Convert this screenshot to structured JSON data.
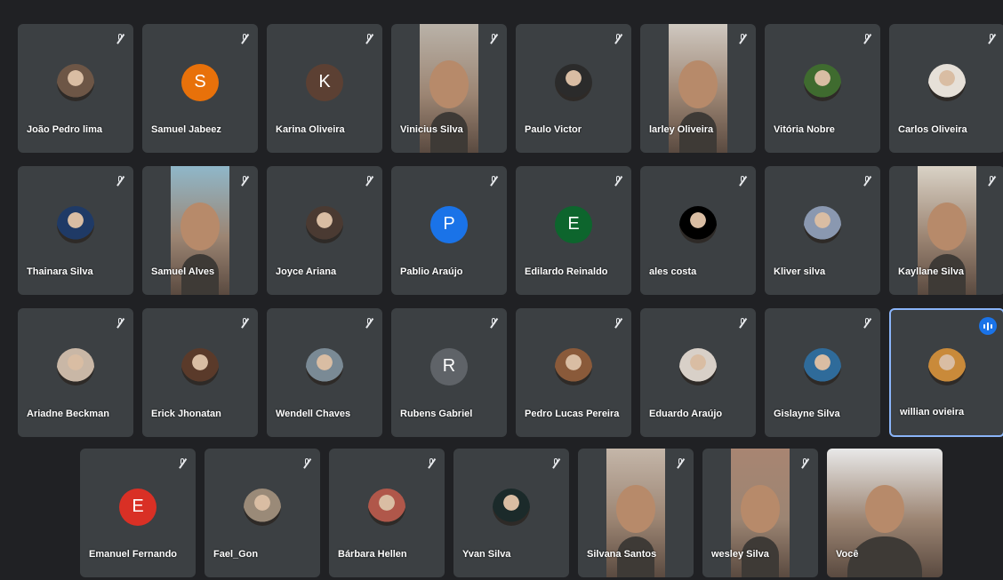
{
  "meeting": {
    "tiles": [
      {
        "name": "João Pedro lima",
        "type": "photo",
        "color": "#6d5646"
      },
      {
        "name": "Samuel Jabeez",
        "type": "initial",
        "initial": "S",
        "color": "#e8710a"
      },
      {
        "name": "Karina Oliveira",
        "type": "initial",
        "initial": "K",
        "color": "#5c4033"
      },
      {
        "name": "Vinicius Silva",
        "type": "video",
        "color": "#b9b2a8"
      },
      {
        "name": "Paulo Victor",
        "type": "photo",
        "color": "#2b2b2b"
      },
      {
        "name": "larley Oliveira",
        "type": "video",
        "color": "#cfc8c0"
      },
      {
        "name": "Vitória Nobre",
        "type": "photo",
        "color": "#3f6b2f"
      },
      {
        "name": "Carlos Oliveira",
        "type": "photo",
        "color": "#e6e0d8"
      },
      {
        "name": "Thainara Silva",
        "type": "photo",
        "color": "#1f3a66"
      },
      {
        "name": "Samuel Alves",
        "type": "video",
        "color": "#8fb7c9"
      },
      {
        "name": "Joyce Ariana",
        "type": "photo",
        "color": "#4a3a32"
      },
      {
        "name": "Pablio Araújo",
        "type": "initial",
        "initial": "P",
        "color": "#1a73e8"
      },
      {
        "name": "Edilardo Reinaldo",
        "type": "initial",
        "initial": "E",
        "color": "#0d652d"
      },
      {
        "name": "ales costa",
        "type": "photo",
        "color": "#000000"
      },
      {
        "name": "Kliver silva",
        "type": "photo",
        "color": "#8a98b0"
      },
      {
        "name": "Kayllane Silva",
        "type": "video",
        "color": "#d9d2c6"
      },
      {
        "name": "Ariadne Beckman",
        "type": "photo",
        "color": "#c9b7a6"
      },
      {
        "name": "Erick Jhonatan",
        "type": "photo",
        "color": "#5a3a2a"
      },
      {
        "name": "Wendell Chaves",
        "type": "photo",
        "color": "#7a8a95"
      },
      {
        "name": "Rubens Gabriel",
        "type": "initial",
        "initial": "R",
        "color": "#5f6368"
      },
      {
        "name": "Pedro Lucas Pereira",
        "type": "photo",
        "color": "#8a5a3a"
      },
      {
        "name": "Eduardo Araújo",
        "type": "photo",
        "color": "#d8d0c8"
      },
      {
        "name": "Gislayne Silva",
        "type": "photo",
        "color": "#2f6b9a"
      },
      {
        "name": "willian ovieira",
        "type": "photo",
        "color": "#c98a3a",
        "active": true
      },
      {
        "name": "Emanuel Fernando",
        "type": "initial",
        "initial": "E",
        "color": "#d93025"
      },
      {
        "name": "Fael_Gon",
        "type": "photo",
        "color": "#9a8a78"
      },
      {
        "name": "Bárbara Hellen",
        "type": "photo",
        "color": "#b0574a"
      },
      {
        "name": "Yvan Silva",
        "type": "photo",
        "color": "#1b2a2a"
      },
      {
        "name": "Silvana Santos",
        "type": "video",
        "color": "#c4b6a9"
      },
      {
        "name": "wesley Silva",
        "type": "video",
        "color": "#a88572"
      },
      {
        "name": "Você",
        "type": "video",
        "color": "#e8e8e8",
        "self": true
      }
    ]
  }
}
